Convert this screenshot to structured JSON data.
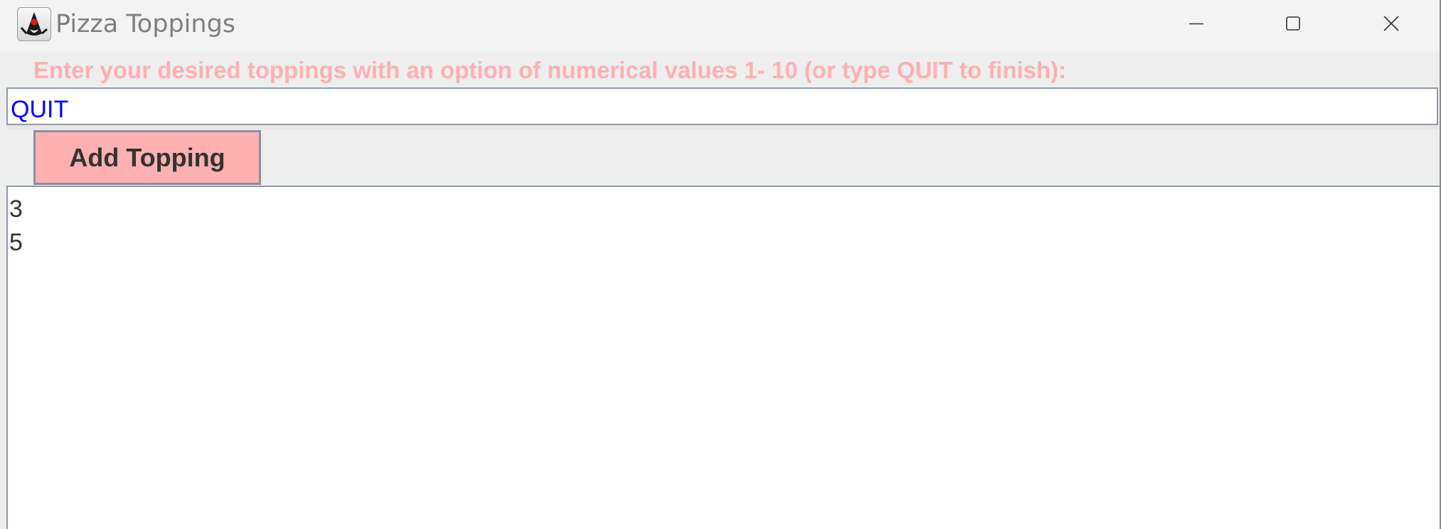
{
  "window": {
    "title": "Pizza Toppings",
    "icon": "java-duke-icon",
    "controls": [
      "minimize-icon",
      "maximize-icon",
      "close-icon"
    ]
  },
  "prompt": {
    "text": "Enter your desired toppings with an option of numerical values 1- 10 (or type QUIT to finish):",
    "color": "#ffb0b0"
  },
  "input": {
    "value": "QUIT",
    "text_color": "#0000ff"
  },
  "button": {
    "label": "Add Topping",
    "background": "#ffb0b0"
  },
  "output": {
    "lines": [
      "3",
      "5"
    ]
  }
}
